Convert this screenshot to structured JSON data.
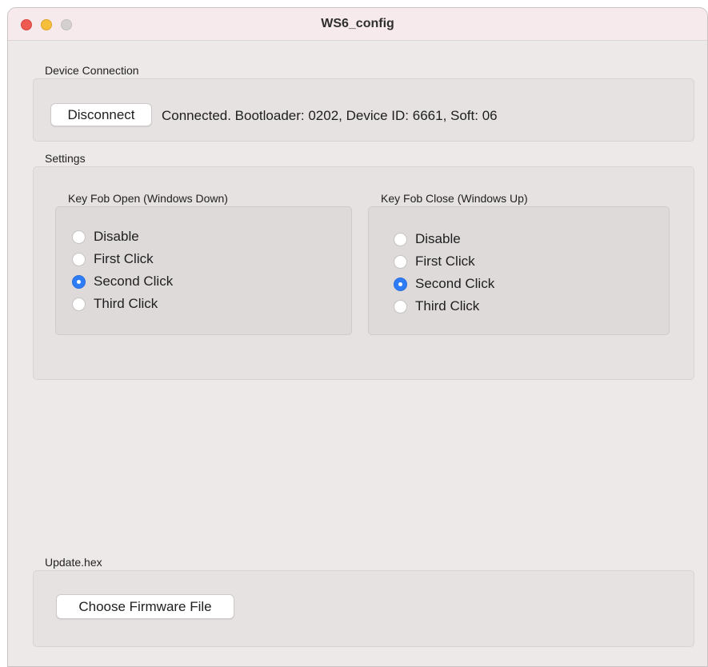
{
  "window": {
    "title": "WS6_config"
  },
  "device_connection": {
    "label": "Device Connection",
    "disconnect_label": "Disconnect",
    "status": "Connected. Bootloader: 0202, Device ID: 6661, Soft: 06"
  },
  "settings": {
    "label": "Settings",
    "open_group": {
      "label": "Key Fob Open (Windows Down)",
      "options": [
        "Disable",
        "First Click",
        "Second Click",
        "Third Click"
      ],
      "selected": "Second Click"
    },
    "close_group": {
      "label": "Key Fob Close (Windows Up)",
      "options": [
        "Disable",
        "First Click",
        "Second Click",
        "Third Click"
      ],
      "selected": "Second Click"
    }
  },
  "update": {
    "label": "Update.hex",
    "choose_label": "Choose Firmware File"
  },
  "colors": {
    "accent": "#2e7cf6",
    "window_bg": "#ede9e9",
    "titlebar_bg": "#f7eaec",
    "close": "#ee5a52",
    "minimize": "#f5be3b",
    "zoom": "#d5d0d0"
  }
}
